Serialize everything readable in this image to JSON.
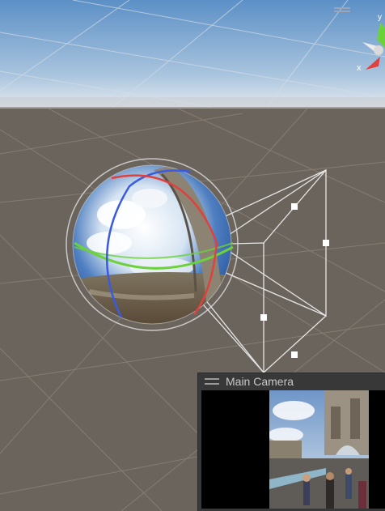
{
  "camera_preview": {
    "title": "Main Camera"
  },
  "orientation_gizmo": {
    "x_label": "x",
    "y_label": "y"
  },
  "colors": {
    "ground": "#6b645c",
    "sky_top": "#5a8ec4",
    "sky_horizon": "#dfe7ee",
    "grid": "#8c847b",
    "gizmo_red": "#e0413c",
    "gizmo_green": "#6cd23c",
    "gizmo_blue": "#3a5ae0",
    "frustum": "#e8e8e8"
  },
  "icons": [
    "panel-grip-icon",
    "scene-orientation-gizmo-icon",
    "reflection-probe-sphere-icon",
    "camera-frustum-icon"
  ]
}
